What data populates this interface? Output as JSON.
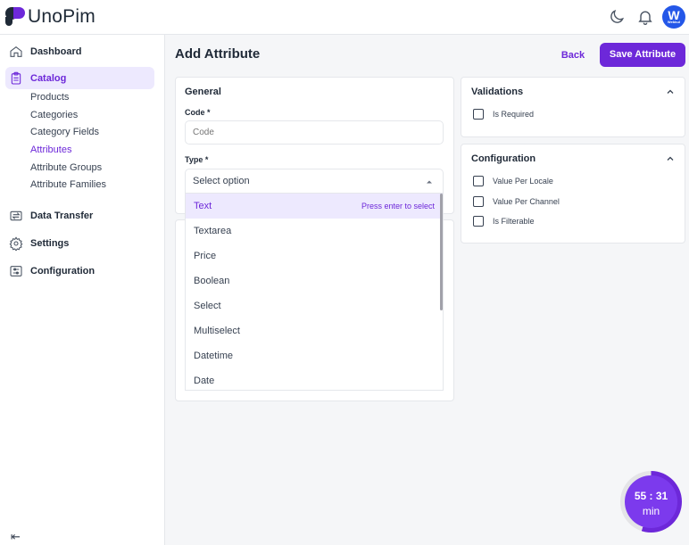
{
  "header": {
    "logo_text": "UnoPim",
    "avatar_letter": "W",
    "avatar_sub": "Webkul",
    "icons": [
      "moon-icon",
      "bell-icon"
    ]
  },
  "sidebar": {
    "items": [
      {
        "label": "Dashboard",
        "icon": "home-icon"
      },
      {
        "label": "Catalog",
        "icon": "clipboard-icon",
        "active": true
      },
      {
        "label": "Data Transfer",
        "icon": "transfer-icon"
      },
      {
        "label": "Settings",
        "icon": "gear-icon"
      },
      {
        "label": "Configuration",
        "icon": "sliders-icon"
      }
    ],
    "catalog_sub": [
      "Products",
      "Categories",
      "Category Fields",
      "Attributes",
      "Attribute Groups",
      "Attribute Families"
    ],
    "active_sub": "Attributes",
    "collapse_icon": "⇤"
  },
  "page": {
    "title": "Add Attribute",
    "back_label": "Back",
    "save_label": "Save Attribute"
  },
  "general": {
    "title": "General",
    "code_label": "Code *",
    "code_placeholder": "Code",
    "type_label": "Type *",
    "type_placeholder": "Select option",
    "options": [
      "Text",
      "Textarea",
      "Price",
      "Boolean",
      "Select",
      "Multiselect",
      "Datetime",
      "Date"
    ],
    "highlighted": "Text",
    "hint": "Press enter to select"
  },
  "validations": {
    "title": "Validations",
    "items": [
      "Is Required"
    ]
  },
  "configuration": {
    "title": "Configuration",
    "items": [
      "Value Per Locale",
      "Value Per Channel",
      "Is Filterable"
    ]
  },
  "timer": {
    "time": "55 : 31",
    "unit": "min",
    "progress": 0.55,
    "color": "#6d28d9"
  },
  "colors": {
    "accent": "#6d28d9",
    "accent_light": "#ede9fe"
  }
}
